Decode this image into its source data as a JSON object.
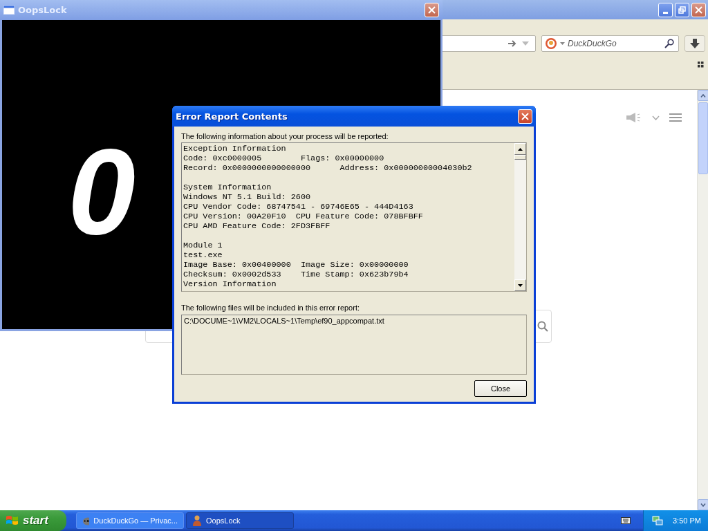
{
  "browser": {
    "search_placeholder": "DuckDuckGo"
  },
  "oopslock": {
    "title": "OopsLock",
    "display": "0"
  },
  "dialog": {
    "title": "Error Report Contents",
    "info_label": "The following information about your process will be reported:",
    "info_blocks": [
      [
        "Exception Information",
        "Code: 0xc0000005        Flags: 0x00000000",
        "Record: 0x0000000000000000      Address: 0x00000000004030b2"
      ],
      [
        "System Information",
        "Windows NT 5.1 Build: 2600",
        "CPU Vendor Code: 68747541 - 69746E65 - 444D4163",
        "CPU Version: 00A20F10  CPU Feature Code: 078BFBFF",
        "CPU AMD Feature Code: 2FD3FBFF"
      ],
      [
        "Module 1",
        "test.exe",
        "Image Base: 0x00400000  Image Size: 0x00000000",
        "Checksum: 0x0002d533    Time Stamp: 0x623b79b4",
        "Version Information"
      ]
    ],
    "files_label": "The following files will be included in this error report:",
    "files": [
      "C:\\DOCUME~1\\VM2\\LOCALS~1\\Temp\\ef90_appcompat.txt"
    ],
    "close_button": "Close"
  },
  "taskbar": {
    "start": "start",
    "tasks": [
      {
        "label": "DuckDuckGo — Privac...",
        "selected": false
      },
      {
        "label": "OopsLock",
        "selected": true
      }
    ],
    "clock": "3:50 PM"
  }
}
